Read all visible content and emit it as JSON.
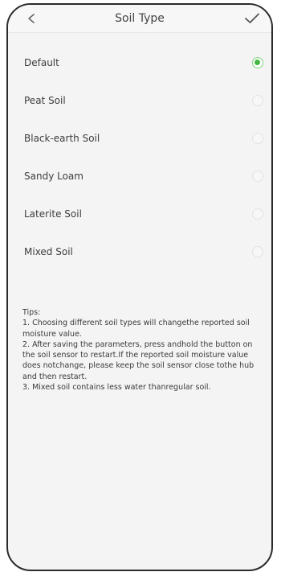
{
  "header": {
    "back_icon": "chevron-left-icon",
    "title": "Soil Type",
    "confirm_icon": "checkmark-icon"
  },
  "soil_types": [
    {
      "label": "Default",
      "selected": true
    },
    {
      "label": "Peat Soil",
      "selected": false
    },
    {
      "label": "Black-earth Soil",
      "selected": false
    },
    {
      "label": "Sandy Loam",
      "selected": false
    },
    {
      "label": "Laterite Soil",
      "selected": false
    },
    {
      "label": "Mixed Soil",
      "selected": false
    }
  ],
  "tips": {
    "heading": "Tips:",
    "lines": [
      "1. Choosing different soil types will changethe reported soil moisture value.",
      "2. After saving the parameters, press andhold the button on the soil sensor to restart.If the reported soil moisture value does notchange, please keep the soil sensor close tothe hub and then restart.",
      "3. Mixed soil contains less water thanregular soil."
    ]
  },
  "colors": {
    "selected_radio": "#43b943",
    "frame": "#2b2b2b",
    "background": "#f4f4f4"
  }
}
